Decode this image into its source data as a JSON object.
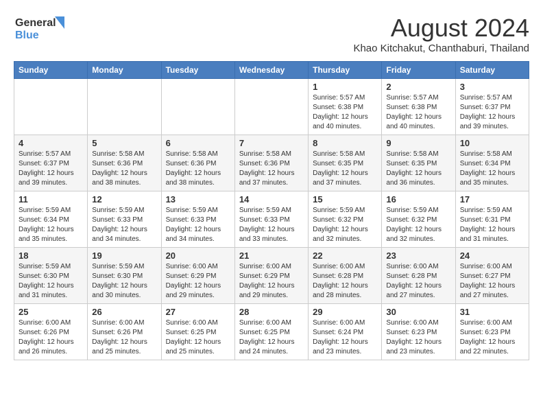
{
  "logo": {
    "line1": "General",
    "line2": "Blue"
  },
  "title": "August 2024",
  "subtitle": "Khao Kitchakut, Chanthaburi, Thailand",
  "days_of_week": [
    "Sunday",
    "Monday",
    "Tuesday",
    "Wednesday",
    "Thursday",
    "Friday",
    "Saturday"
  ],
  "weeks": [
    [
      {
        "day": "",
        "info": ""
      },
      {
        "day": "",
        "info": ""
      },
      {
        "day": "",
        "info": ""
      },
      {
        "day": "",
        "info": ""
      },
      {
        "day": "1",
        "info": "Sunrise: 5:57 AM\nSunset: 6:38 PM\nDaylight: 12 hours\nand 40 minutes."
      },
      {
        "day": "2",
        "info": "Sunrise: 5:57 AM\nSunset: 6:38 PM\nDaylight: 12 hours\nand 40 minutes."
      },
      {
        "day": "3",
        "info": "Sunrise: 5:57 AM\nSunset: 6:37 PM\nDaylight: 12 hours\nand 39 minutes."
      }
    ],
    [
      {
        "day": "4",
        "info": "Sunrise: 5:57 AM\nSunset: 6:37 PM\nDaylight: 12 hours\nand 39 minutes."
      },
      {
        "day": "5",
        "info": "Sunrise: 5:58 AM\nSunset: 6:36 PM\nDaylight: 12 hours\nand 38 minutes."
      },
      {
        "day": "6",
        "info": "Sunrise: 5:58 AM\nSunset: 6:36 PM\nDaylight: 12 hours\nand 38 minutes."
      },
      {
        "day": "7",
        "info": "Sunrise: 5:58 AM\nSunset: 6:36 PM\nDaylight: 12 hours\nand 37 minutes."
      },
      {
        "day": "8",
        "info": "Sunrise: 5:58 AM\nSunset: 6:35 PM\nDaylight: 12 hours\nand 37 minutes."
      },
      {
        "day": "9",
        "info": "Sunrise: 5:58 AM\nSunset: 6:35 PM\nDaylight: 12 hours\nand 36 minutes."
      },
      {
        "day": "10",
        "info": "Sunrise: 5:58 AM\nSunset: 6:34 PM\nDaylight: 12 hours\nand 35 minutes."
      }
    ],
    [
      {
        "day": "11",
        "info": "Sunrise: 5:59 AM\nSunset: 6:34 PM\nDaylight: 12 hours\nand 35 minutes."
      },
      {
        "day": "12",
        "info": "Sunrise: 5:59 AM\nSunset: 6:33 PM\nDaylight: 12 hours\nand 34 minutes."
      },
      {
        "day": "13",
        "info": "Sunrise: 5:59 AM\nSunset: 6:33 PM\nDaylight: 12 hours\nand 34 minutes."
      },
      {
        "day": "14",
        "info": "Sunrise: 5:59 AM\nSunset: 6:33 PM\nDaylight: 12 hours\nand 33 minutes."
      },
      {
        "day": "15",
        "info": "Sunrise: 5:59 AM\nSunset: 6:32 PM\nDaylight: 12 hours\nand 32 minutes."
      },
      {
        "day": "16",
        "info": "Sunrise: 5:59 AM\nSunset: 6:32 PM\nDaylight: 12 hours\nand 32 minutes."
      },
      {
        "day": "17",
        "info": "Sunrise: 5:59 AM\nSunset: 6:31 PM\nDaylight: 12 hours\nand 31 minutes."
      }
    ],
    [
      {
        "day": "18",
        "info": "Sunrise: 5:59 AM\nSunset: 6:30 PM\nDaylight: 12 hours\nand 31 minutes."
      },
      {
        "day": "19",
        "info": "Sunrise: 5:59 AM\nSunset: 6:30 PM\nDaylight: 12 hours\nand 30 minutes."
      },
      {
        "day": "20",
        "info": "Sunrise: 6:00 AM\nSunset: 6:29 PM\nDaylight: 12 hours\nand 29 minutes."
      },
      {
        "day": "21",
        "info": "Sunrise: 6:00 AM\nSunset: 6:29 PM\nDaylight: 12 hours\nand 29 minutes."
      },
      {
        "day": "22",
        "info": "Sunrise: 6:00 AM\nSunset: 6:28 PM\nDaylight: 12 hours\nand 28 minutes."
      },
      {
        "day": "23",
        "info": "Sunrise: 6:00 AM\nSunset: 6:28 PM\nDaylight: 12 hours\nand 27 minutes."
      },
      {
        "day": "24",
        "info": "Sunrise: 6:00 AM\nSunset: 6:27 PM\nDaylight: 12 hours\nand 27 minutes."
      }
    ],
    [
      {
        "day": "25",
        "info": "Sunrise: 6:00 AM\nSunset: 6:26 PM\nDaylight: 12 hours\nand 26 minutes."
      },
      {
        "day": "26",
        "info": "Sunrise: 6:00 AM\nSunset: 6:26 PM\nDaylight: 12 hours\nand 25 minutes."
      },
      {
        "day": "27",
        "info": "Sunrise: 6:00 AM\nSunset: 6:25 PM\nDaylight: 12 hours\nand 25 minutes."
      },
      {
        "day": "28",
        "info": "Sunrise: 6:00 AM\nSunset: 6:25 PM\nDaylight: 12 hours\nand 24 minutes."
      },
      {
        "day": "29",
        "info": "Sunrise: 6:00 AM\nSunset: 6:24 PM\nDaylight: 12 hours\nand 23 minutes."
      },
      {
        "day": "30",
        "info": "Sunrise: 6:00 AM\nSunset: 6:23 PM\nDaylight: 12 hours\nand 23 minutes."
      },
      {
        "day": "31",
        "info": "Sunrise: 6:00 AM\nSunset: 6:23 PM\nDaylight: 12 hours\nand 22 minutes."
      }
    ]
  ]
}
